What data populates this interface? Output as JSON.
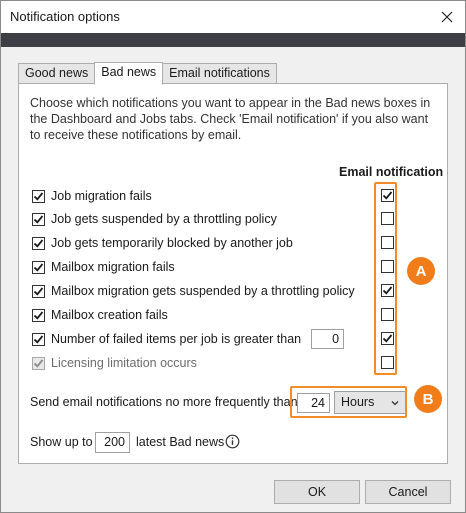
{
  "window": {
    "title": "Notification options"
  },
  "tabs": [
    {
      "label": "Good news",
      "active": false
    },
    {
      "label": "Bad news",
      "active": true
    },
    {
      "label": "Email notifications",
      "active": false
    }
  ],
  "intro_text": "Choose which notifications you want to appear in the Bad news boxes in the Dashboard and Jobs tabs. Check 'Email notification' if you also want to receive these notifications by email.",
  "email_header": "Email notification",
  "items": [
    {
      "label": "Job migration fails",
      "checked": true,
      "email": true
    },
    {
      "label": "Job gets suspended by a throttling policy",
      "checked": true,
      "email": false
    },
    {
      "label": "Job gets temporarily blocked by another job",
      "checked": true,
      "email": false
    },
    {
      "label": "Mailbox migration fails",
      "checked": true,
      "email": false
    },
    {
      "label": "Mailbox migration gets suspended by a throttling policy",
      "checked": true,
      "email": true
    },
    {
      "label": "Mailbox creation fails",
      "checked": true,
      "email": false
    },
    {
      "label": "Number of failed items per job is greater than",
      "checked": true,
      "email": true,
      "value": "0"
    },
    {
      "label": "Licensing limitation occurs",
      "checked": true,
      "disabled": true,
      "email": false
    }
  ],
  "frequency": {
    "label": "Send email notifications no more frequently than",
    "value": "24",
    "unit": "Hours"
  },
  "showup": {
    "before": "Show up to",
    "value": "200",
    "after": "latest Bad news"
  },
  "badges": {
    "a": "A",
    "b": "B"
  },
  "buttons": {
    "ok": "OK",
    "cancel": "Cancel"
  },
  "colors": {
    "highlight": "#f28c28",
    "badge": "#f07d1a",
    "band": "#3c3f44"
  },
  "icons": {
    "close": "close-icon",
    "info": "info-icon",
    "dropdown": "chevron-down-icon"
  }
}
